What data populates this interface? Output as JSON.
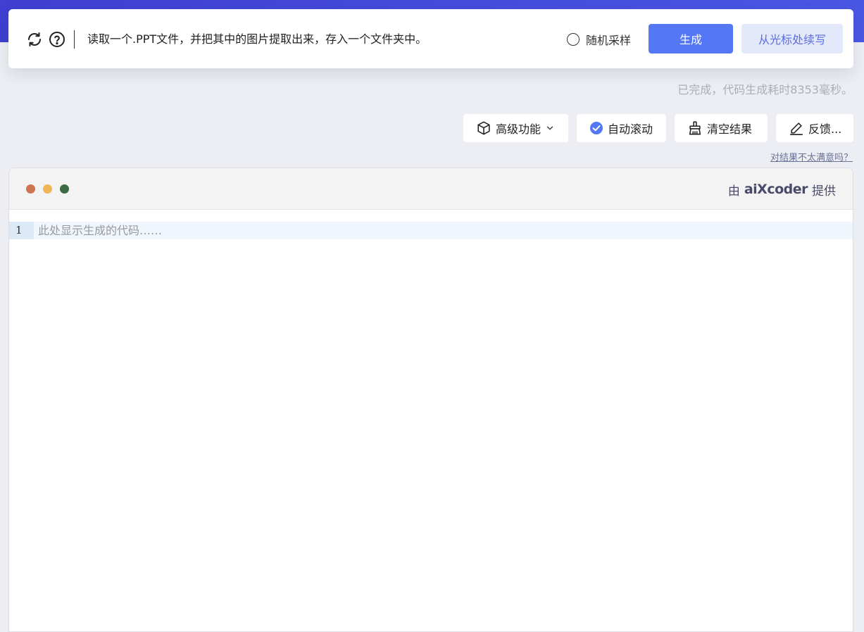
{
  "prompt": {
    "text": "读取一个.PPT文件，并把其中的图片提取出来，存入一个文件夹中。",
    "random_sampling_label": "随机采样",
    "generate_label": "生成",
    "continue_label": "从光标处续写"
  },
  "status": {
    "text": "已完成，代码生成耗时8353毫秒。"
  },
  "toolbar": {
    "advanced_label": "高级功能",
    "autoscroll_label": "自动滚动",
    "clear_label": "清空结果",
    "feedback_label": "反馈..."
  },
  "feedback_link": "对结果不太满意吗？",
  "editor": {
    "credit_prefix": "由",
    "credit_brand": "aiXcoder",
    "credit_suffix": "提供",
    "line_number": "1",
    "placeholder": "此处显示生成的代码……"
  },
  "colors": {
    "accent": "#5478f5",
    "dot_red": "#cf7451",
    "dot_yellow": "#f0b655",
    "dot_green": "#3a6b45"
  }
}
